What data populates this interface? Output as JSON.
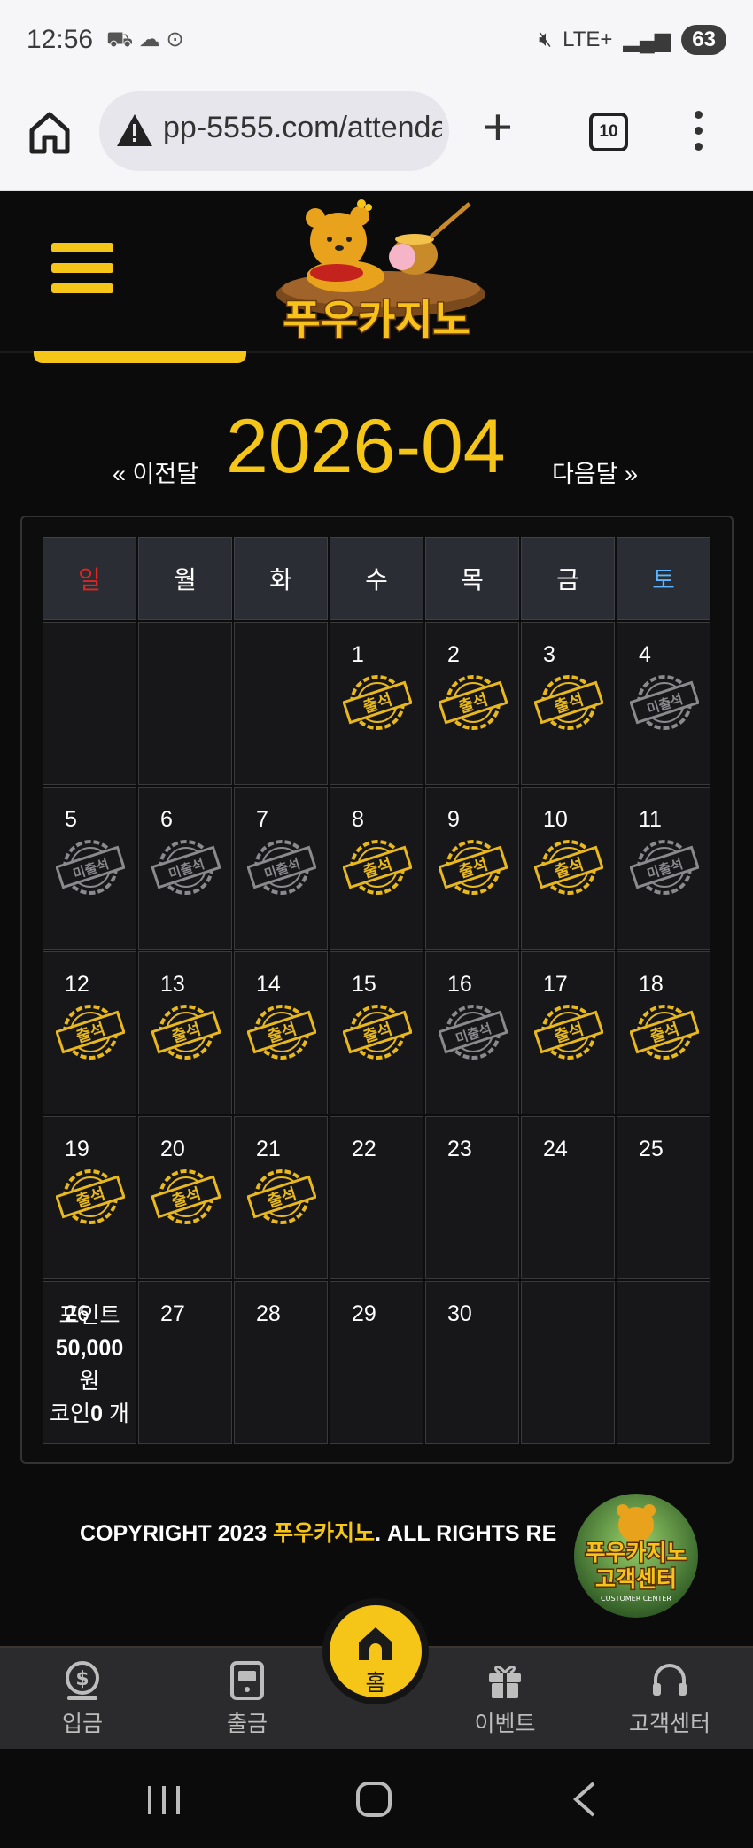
{
  "status_bar": {
    "time": "12:56",
    "network": "LTE+",
    "battery": "63"
  },
  "browser": {
    "url": "pp-5555.com/attendance",
    "tab_count": "10"
  },
  "site": {
    "logo_text": "푸우카지노",
    "accent_color": "#f5c518"
  },
  "month_nav": {
    "prev_label": "« 이전달",
    "title": "2026-04",
    "next_label": "다음달 »"
  },
  "calendar": {
    "weekdays": [
      "일",
      "월",
      "화",
      "수",
      "목",
      "금",
      "토"
    ],
    "weeks": [
      [
        {
          "day": "",
          "stamp": ""
        },
        {
          "day": "",
          "stamp": ""
        },
        {
          "day": "",
          "stamp": ""
        },
        {
          "day": "1",
          "stamp": "출석"
        },
        {
          "day": "2",
          "stamp": "출석"
        },
        {
          "day": "3",
          "stamp": "출석"
        },
        {
          "day": "4",
          "stamp": "미출석"
        }
      ],
      [
        {
          "day": "5",
          "stamp": "미출석"
        },
        {
          "day": "6",
          "stamp": "미출석"
        },
        {
          "day": "7",
          "stamp": "미출석"
        },
        {
          "day": "8",
          "stamp": "출석"
        },
        {
          "day": "9",
          "stamp": "출석"
        },
        {
          "day": "10",
          "stamp": "출석"
        },
        {
          "day": "11",
          "stamp": "미출석"
        }
      ],
      [
        {
          "day": "12",
          "stamp": "출석"
        },
        {
          "day": "13",
          "stamp": "출석"
        },
        {
          "day": "14",
          "stamp": "출석"
        },
        {
          "day": "15",
          "stamp": "출석"
        },
        {
          "day": "16",
          "stamp": "미출석"
        },
        {
          "day": "17",
          "stamp": "출석"
        },
        {
          "day": "18",
          "stamp": "출석"
        }
      ],
      [
        {
          "day": "19",
          "stamp": "출석"
        },
        {
          "day": "20",
          "stamp": "출석"
        },
        {
          "day": "21",
          "stamp": "출석"
        },
        {
          "day": "22",
          "stamp": ""
        },
        {
          "day": "23",
          "stamp": ""
        },
        {
          "day": "24",
          "stamp": ""
        },
        {
          "day": "25",
          "stamp": ""
        }
      ],
      [
        {
          "day": "26",
          "stamp": ""
        },
        {
          "day": "27",
          "stamp": ""
        },
        {
          "day": "28",
          "stamp": ""
        },
        {
          "day": "29",
          "stamp": ""
        },
        {
          "day": "30",
          "stamp": ""
        },
        {
          "day": "",
          "stamp": ""
        },
        {
          "day": "",
          "stamp": ""
        }
      ]
    ],
    "reward": {
      "line1": "포인트",
      "amount": "50,000",
      "unit": "원",
      "coin_label": "코인",
      "coin_value": "0",
      "coin_unit": "개"
    }
  },
  "footer": {
    "copyright_prefix": "COPYRIGHT 2023 ",
    "copyright_brand": "푸우카지노",
    "copyright_suffix": ". ALL RIGHTS RE",
    "cs_badge_title": "푸우카지노",
    "cs_badge_sub": "고객센터",
    "cs_badge_en": "CUSTOMER CENTER"
  },
  "bottom_nav": {
    "deposit": "입금",
    "withdraw": "출금",
    "home": "홈",
    "event": "이벤트",
    "support": "고객센터"
  }
}
